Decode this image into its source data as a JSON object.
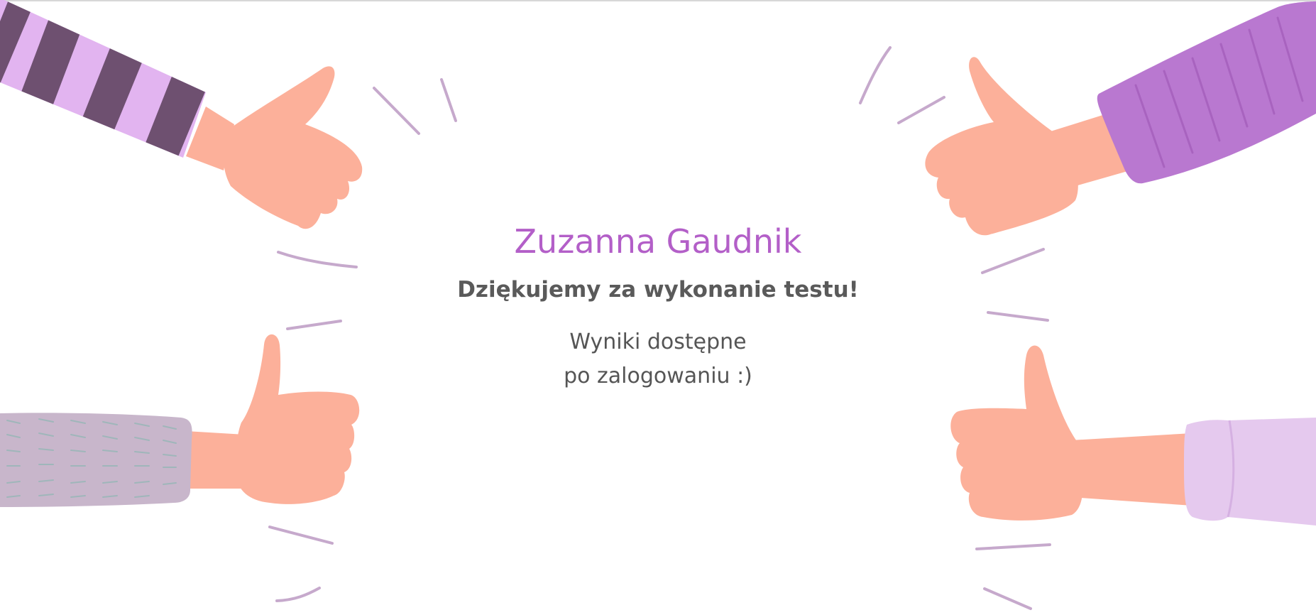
{
  "page": {
    "user_name": "Zuzanna Gaudnik",
    "thanks_message": "Dziękujemy za wykonanie testu!",
    "results_line_1": "Wyniki dostępne",
    "results_line_2": "po zalogowaniu :)"
  },
  "illustration": {
    "icons": [
      "thumbs-up-top-left-icon",
      "thumbs-up-bottom-left-icon",
      "thumbs-up-top-right-icon",
      "thumbs-up-bottom-right-icon",
      "motion-lines-icon"
    ],
    "colors": {
      "skin": "#fcb09a",
      "accent_purple": "#b35fc8",
      "sleeve_stripe_light": "#e2b4f0",
      "sleeve_stripe_dark": "#6e5070",
      "sleeve_knit": "#c8b6cb",
      "sleeve_lavender": "#e5c9ee",
      "motion_lines": "#c6a9cc",
      "text_gray": "#5a5a5a"
    }
  }
}
